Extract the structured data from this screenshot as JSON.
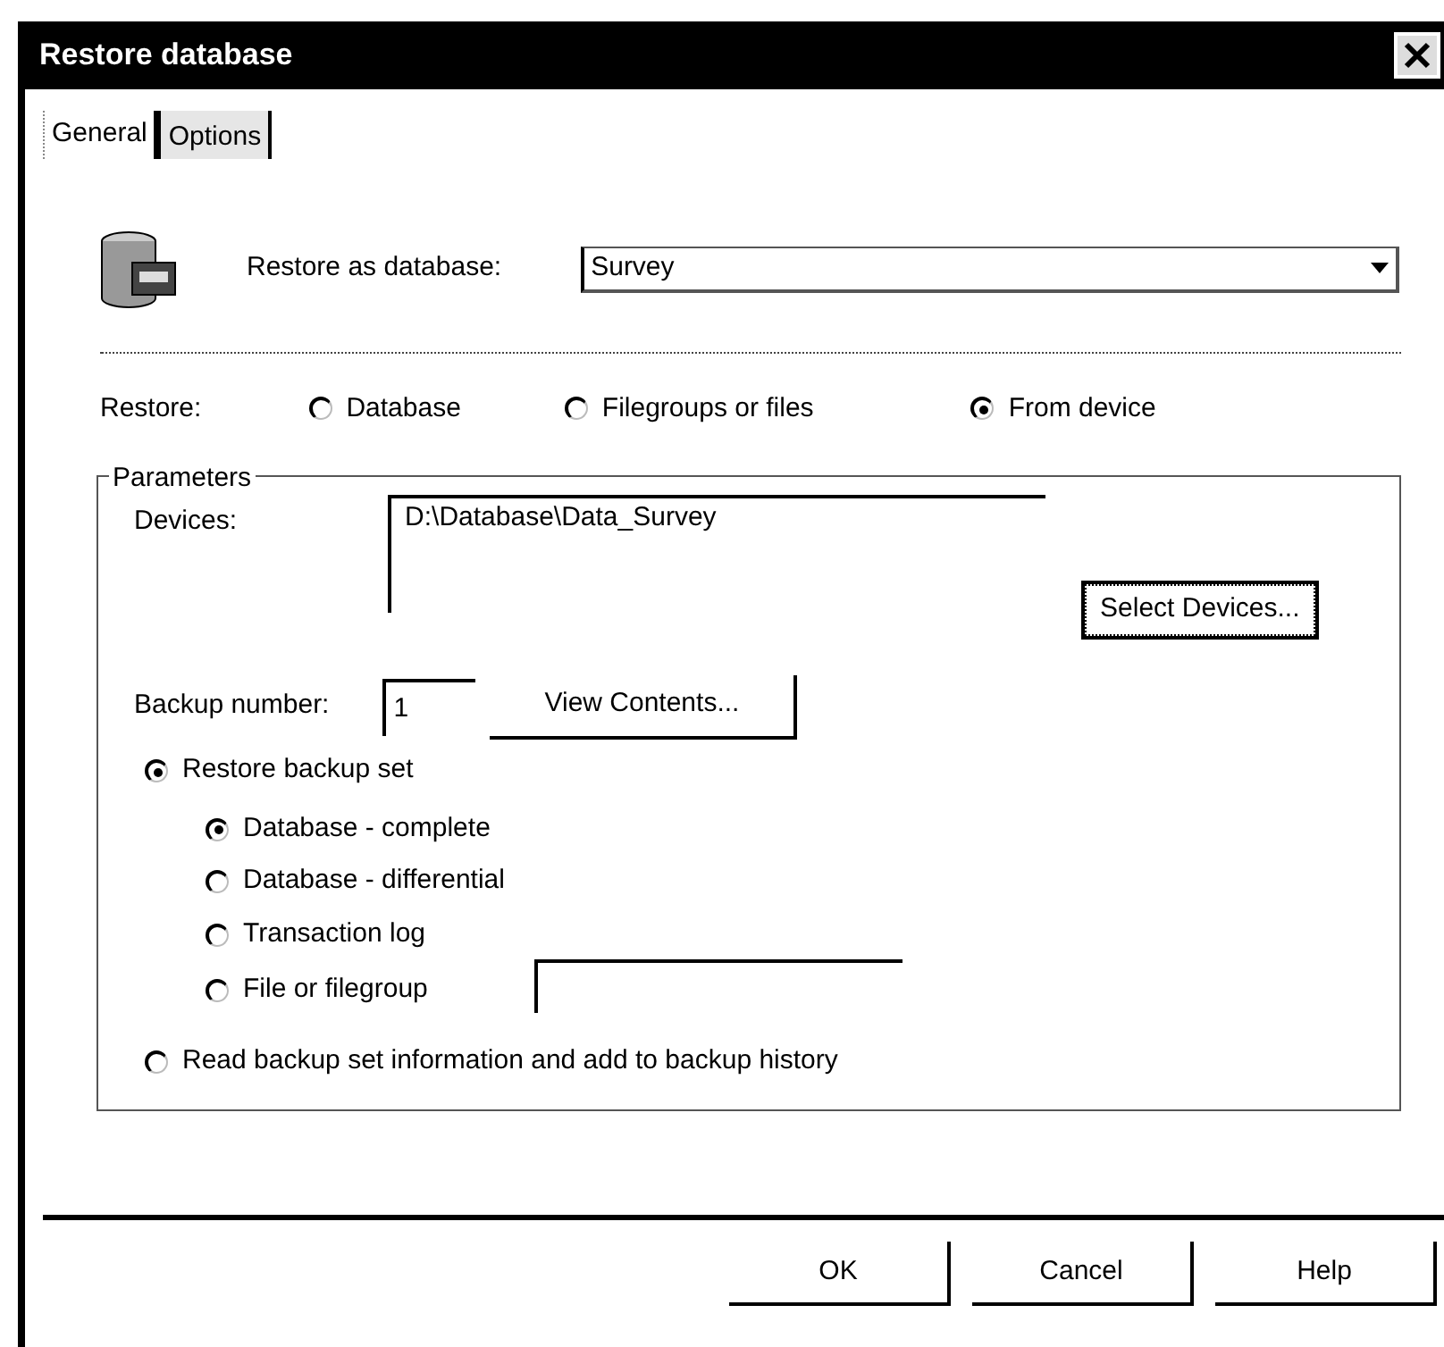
{
  "window": {
    "title": "Restore database"
  },
  "tabs": [
    {
      "label": "General",
      "selected": true
    },
    {
      "label": "Options",
      "selected": false
    }
  ],
  "restore_as": {
    "label": "Restore as database:",
    "value": "Survey"
  },
  "restore": {
    "label": "Restore:",
    "options": [
      {
        "label": "Database",
        "selected": false
      },
      {
        "label": "Filegroups or files",
        "selected": false
      },
      {
        "label": "From device",
        "selected": true
      }
    ]
  },
  "parameters": {
    "title": "Parameters",
    "devices_label": "Devices:",
    "devices": [
      "D:\\Database\\Data_Survey"
    ],
    "select_devices": "Select Devices...",
    "backup_number_label": "Backup number:",
    "backup_number": "1",
    "view_contents": "View Contents...",
    "modes": [
      {
        "label": "Restore backup set",
        "selected": true,
        "children": [
          {
            "label": "Database - complete",
            "selected": true,
            "kind": "plain"
          },
          {
            "label": "Database - differential",
            "selected": false,
            "kind": "plain"
          },
          {
            "label": "Transaction log",
            "selected": false,
            "kind": "plain"
          },
          {
            "label": "File or filegroup",
            "selected": false,
            "kind": "field"
          }
        ]
      },
      {
        "label": "Read backup set information and add to backup history",
        "selected": false
      }
    ]
  },
  "buttons": [
    "OK",
    "Cancel",
    "Help"
  ]
}
